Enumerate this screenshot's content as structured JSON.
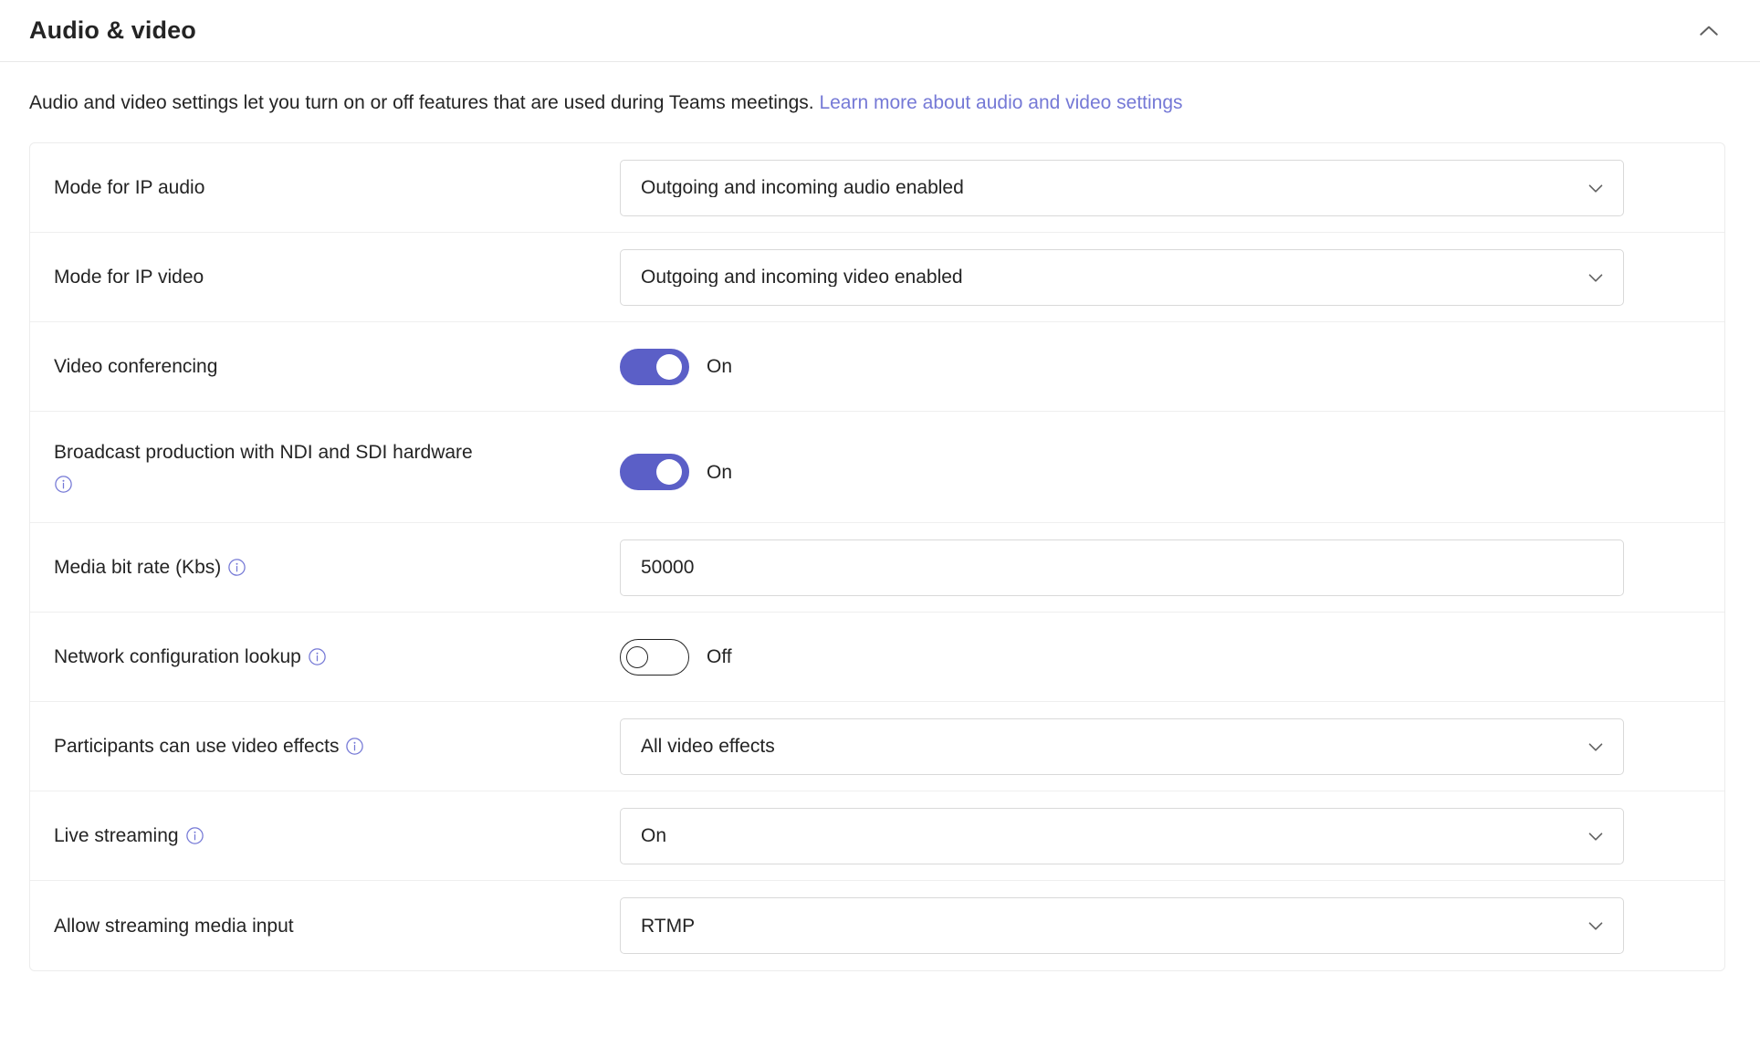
{
  "header": {
    "title": "Audio & video",
    "collapse_icon": "chevron-up-icon"
  },
  "description": {
    "text": "Audio and video settings let you turn on or off features that are used during Teams meetings.",
    "link_text": "Learn more about audio and video settings"
  },
  "colors": {
    "toggle_on": "#5B5FC7",
    "link": "#7579D6",
    "info_icon": "#7579D6",
    "text": "#242424",
    "border": "#D9D9D9"
  },
  "settings": [
    {
      "label": "Mode for IP audio",
      "type": "dropdown",
      "value": "Outgoing and incoming audio enabled",
      "has_info": false,
      "chevron_icon": "chevron-down-icon"
    },
    {
      "label": "Mode for IP video",
      "type": "dropdown",
      "value": "Outgoing and incoming video enabled",
      "has_info": false,
      "chevron_icon": "chevron-down-icon"
    },
    {
      "label": "Video conferencing",
      "type": "toggle",
      "value": "On",
      "state": "on",
      "has_info": false
    },
    {
      "label": "Broadcast production with NDI and SDI hardware",
      "type": "toggle",
      "value": "On",
      "state": "on",
      "has_info": true,
      "info_icon": "info-icon",
      "wrapped": true
    },
    {
      "label": "Media bit rate (Kbs)",
      "type": "text",
      "value": "50000",
      "has_info": true,
      "info_icon": "info-icon"
    },
    {
      "label": "Network configuration lookup",
      "type": "toggle",
      "value": "Off",
      "state": "off",
      "has_info": true,
      "info_icon": "info-icon"
    },
    {
      "label": "Participants can use video effects",
      "type": "dropdown",
      "value": "All video effects",
      "has_info": true,
      "info_icon": "info-icon",
      "chevron_icon": "chevron-down-icon"
    },
    {
      "label": "Live streaming",
      "type": "dropdown",
      "value": "On",
      "has_info": true,
      "info_icon": "info-icon",
      "chevron_icon": "chevron-down-icon"
    },
    {
      "label": "Allow streaming media input",
      "type": "dropdown",
      "value": "RTMP",
      "has_info": false,
      "chevron_icon": "chevron-down-icon"
    }
  ]
}
